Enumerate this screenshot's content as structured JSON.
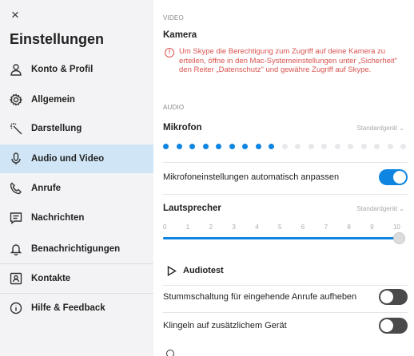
{
  "sidebar": {
    "close_glyph": "×",
    "title": "Einstellungen",
    "items": [
      {
        "label": "Konto & Profil",
        "icon": "person-icon"
      },
      {
        "label": "Allgemein",
        "icon": "gear-icon"
      },
      {
        "label": "Darstellung",
        "icon": "magic-wand-icon"
      },
      {
        "label": "Audio und Video",
        "icon": "microphone-icon",
        "active": true
      },
      {
        "label": "Anrufe",
        "icon": "phone-icon"
      },
      {
        "label": "Nachrichten",
        "icon": "message-icon"
      },
      {
        "label": "Benachrichtigungen",
        "icon": "bell-icon"
      },
      {
        "label": "Kontakte",
        "icon": "contacts-icon"
      },
      {
        "label": "Hilfe & Feedback",
        "icon": "info-icon"
      }
    ]
  },
  "main": {
    "video": {
      "section_label": "VIDEO",
      "heading": "Kamera",
      "warning": "Um Skype die Berechtigung zum Zugriff auf deine Kamera zu erteilen, öffne in den Mac-Systemeinstellungen unter „Sicherheit\" den Reiter „Datenschutz\" und gewähre Zugriff auf Skype."
    },
    "audio": {
      "section_label": "AUDIO",
      "mic_heading": "Mikrofon",
      "mic_device": "Standardgerät ⌄",
      "mic_level_active_dots": 9,
      "mic_level_total_dots": 19,
      "auto_adjust_label": "Mikrofoneinstellungen automatisch anpassen",
      "auto_adjust_on": true,
      "speaker_heading": "Lautsprecher",
      "speaker_device": "Standardgerät ⌄",
      "volume_ticks": [
        "0",
        "1",
        "2",
        "3",
        "4",
        "5",
        "6",
        "7",
        "8",
        "9",
        "10"
      ],
      "volume_value": 10,
      "audiotest_label": "Audiotest",
      "unmute_label": "Stummschaltung für eingehende Anrufe aufheben",
      "unmute_on": false,
      "ring_label": "Klingeln auf zusätzlichem Gerät",
      "ring_on": false
    }
  },
  "colors": {
    "accent": "#0e85e0",
    "warning": "#d9534f",
    "sidebar_bg": "#f3f3f5",
    "active_bg": "#d0e6f6"
  }
}
